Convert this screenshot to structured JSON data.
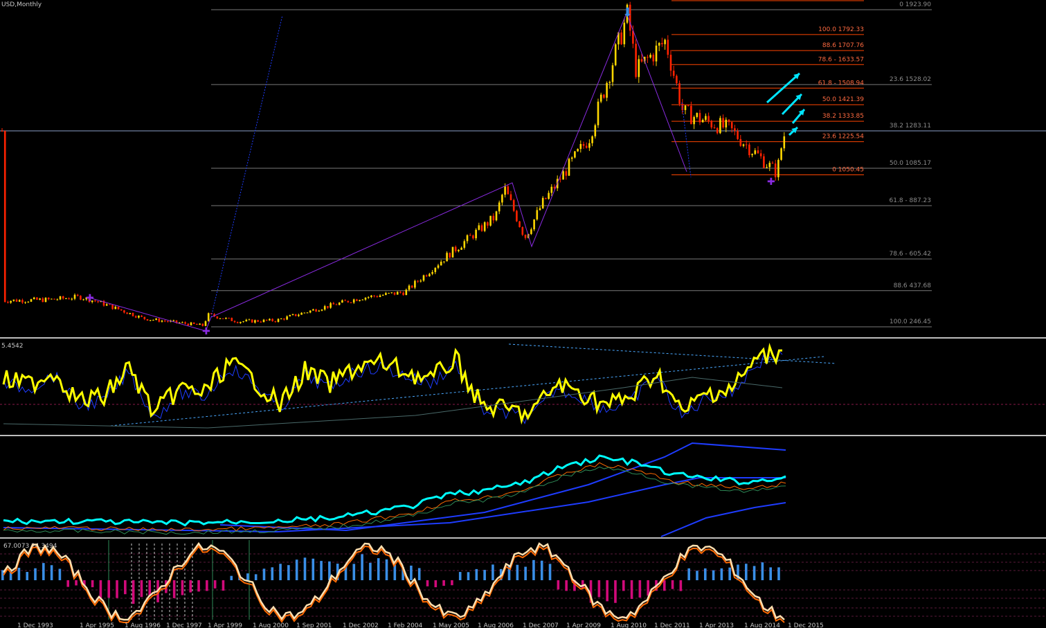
{
  "window": {
    "symbol_label": "USD,Monthly",
    "osc1_value": "5.4542",
    "osc3_values": "67.0073 24.3494"
  },
  "colors": {
    "background": "#000000",
    "candle_up": "#ffd700",
    "candle_down": "#ff2200",
    "fib_main": "#7a7a7a",
    "fib_recent": "#ff4500",
    "arrow": "#00e5ff",
    "purple": "#8a2be2",
    "yellow": "#ffff00",
    "cyan": "#00ffff",
    "blue": "#1e3cff",
    "magenta": "#d10a7a",
    "histo_blue": "#3a8ee6",
    "cream": "#ffe0b0",
    "orange": "#ff6a00"
  },
  "chart_data": [
    {
      "type": "line",
      "panel": "price",
      "title": "USD,Monthly",
      "x_dates": [
        "1 Dec 1993",
        "1 Apr 1995",
        "1 Aug 1996",
        "1 Dec 1997",
        "1 Apr 1999",
        "1 Aug 2000",
        "1 Sep 2001",
        "1 Dec 2002",
        "1 Feb 2004",
        "1 May 2005",
        "1 Aug 2006",
        "1 Dec 2007",
        "1 Apr 2009",
        "1 Aug 2010",
        "1 Dec 2011",
        "1 Apr 2013",
        "1 Aug 2014",
        "1 Dec 2015"
      ],
      "price_series": [
        {
          "x": "1 Dec 1993",
          "y": 385
        },
        {
          "x": "1 Apr 1995",
          "y": 390
        },
        {
          "x": "1 Feb 1996",
          "y": 405
        },
        {
          "x": "1 Aug 1996",
          "y": 380
        },
        {
          "x": "1 Dec 1997",
          "y": 290
        },
        {
          "x": "1 Aug 1999",
          "y": 253
        },
        {
          "x": "1 Oct 1999",
          "y": 310
        },
        {
          "x": "1 Aug 2000",
          "y": 275
        },
        {
          "x": "1 Sep 2001",
          "y": 280
        },
        {
          "x": "1 Dec 2002",
          "y": 345
        },
        {
          "x": "1 Feb 2004",
          "y": 400
        },
        {
          "x": "1 May 2005",
          "y": 430
        },
        {
          "x": "1 Aug 2006",
          "y": 630
        },
        {
          "x": "1 Dec 2007",
          "y": 830
        },
        {
          "x": "1 Mar 2008",
          "y": 980
        },
        {
          "x": "1 Oct 2008",
          "y": 720
        },
        {
          "x": "1 Apr 2009",
          "y": 900
        },
        {
          "x": "1 Aug 2010",
          "y": 1250
        },
        {
          "x": "1 Sep 2011",
          "y": 1900
        },
        {
          "x": "1 Dec 2011",
          "y": 1600
        },
        {
          "x": "1 Oct 2012",
          "y": 1760
        },
        {
          "x": "1 Apr 2013",
          "y": 1380
        },
        {
          "x": "1 Aug 2014",
          "y": 1290
        },
        {
          "x": "1 Dec 2015",
          "y": 1060
        },
        {
          "x": "1 Feb 2016",
          "y": 1240
        },
        {
          "x": "1 Mar 2016",
          "y": 1283
        }
      ],
      "fib_levels_main": [
        {
          "label": "0 1923.90",
          "value": 1923.9
        },
        {
          "label": "23.6 1528.02",
          "value": 1528.02
        },
        {
          "label": "38.2 1283.11",
          "value": 1283.11
        },
        {
          "label": "50.0 1085.17",
          "value": 1085.17
        },
        {
          "label": "61.8 - 887.23",
          "value": 887.23
        },
        {
          "label": "78.6 - 605.42",
          "value": 605.42
        },
        {
          "label": "88.6 437.68",
          "value": 437.68
        },
        {
          "label": "100.0 246.45",
          "value": 246.45
        }
      ],
      "fib_levels_recent": [
        {
          "label": "100.0 1792.33",
          "value": 1792.33
        },
        {
          "label": "88.6 1707.76",
          "value": 1707.76
        },
        {
          "label": "78.6 - 1633.57",
          "value": 1633.57
        },
        {
          "label": "61.8 - 1508.94",
          "value": 1508.94
        },
        {
          "label": "50.0 1421.39",
          "value": 1421.39
        },
        {
          "label": "38.2 1333.85",
          "value": 1333.85
        },
        {
          "label": "23.6 1225.54",
          "value": 1225.54
        },
        {
          "label": "0 1050.45",
          "value": 1050.45
        }
      ],
      "ylim": [
        246.45,
        1923.9
      ]
    },
    {
      "type": "line",
      "panel": "oscillator-1",
      "value_label": "5.4542",
      "series": [
        {
          "values": [
            60,
            55,
            70,
            35,
            40,
            75,
            20,
            50,
            45,
            80,
            60,
            30,
            70,
            55,
            75,
            80,
            70,
            60,
            85,
            30,
            25,
            20,
            55,
            45,
            30,
            40,
            70,
            20,
            45,
            50,
            85,
            95
          ]
        }
      ]
    },
    {
      "type": "line",
      "panel": "oscillator-2",
      "series": [
        {
          "values": [
            10,
            10,
            10,
            9,
            8,
            8,
            9,
            10,
            12,
            15,
            22,
            30,
            45,
            50,
            60,
            80,
            92,
            85,
            70,
            65,
            60,
            68
          ]
        }
      ]
    },
    {
      "type": "bar",
      "panel": "oscillator-3",
      "value_label": "67.0073 24.3494",
      "histogram": [
        40,
        50,
        -20,
        -60,
        -70,
        -50,
        -30,
        20,
        50,
        60,
        55,
        70,
        45,
        -20,
        30,
        50,
        60,
        -40,
        -60,
        -50,
        -30,
        40,
        55,
        60
      ]
    }
  ]
}
